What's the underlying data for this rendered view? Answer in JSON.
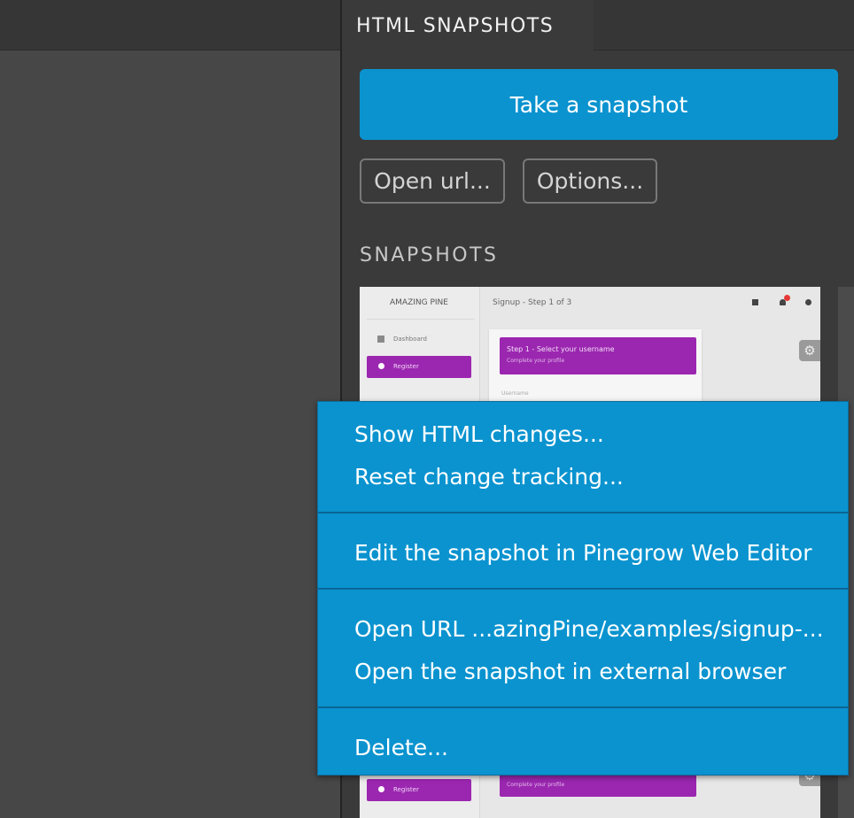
{
  "panel": {
    "title": "HTML SNAPSHOTS",
    "take_snapshot_label": "Take a snapshot",
    "open_url_label": "Open url...",
    "options_label": "Options...",
    "snapshots_section_label": "SNAPSHOTS"
  },
  "snapshot_preview": {
    "brand": "AMAZING PINE",
    "page_title": "Signup - Step 1 of 3",
    "nav_dashboard": "Dashboard",
    "nav_register": "Register",
    "card_title": "Step 1 - Select your username",
    "card_subtitle": "Complete your profile",
    "field_label": "Username"
  },
  "snapshot_preview_2": {
    "nav_register": "Register",
    "card_subtitle": "Complete your profile"
  },
  "context_menu": {
    "items": [
      {
        "label": "Show HTML changes..."
      },
      {
        "label": "Reset change tracking..."
      },
      {
        "label": "Edit the snapshot in Pinegrow Web Editor"
      },
      {
        "label": "Open URL ...azingPine/examples/signup-..."
      },
      {
        "label": "Open the snapshot in external browser"
      },
      {
        "label": "Delete..."
      }
    ]
  },
  "colors": {
    "accent": "#0a93cf",
    "panel_bg": "#3a3a3a",
    "preview_accent": "#9b27b0"
  }
}
